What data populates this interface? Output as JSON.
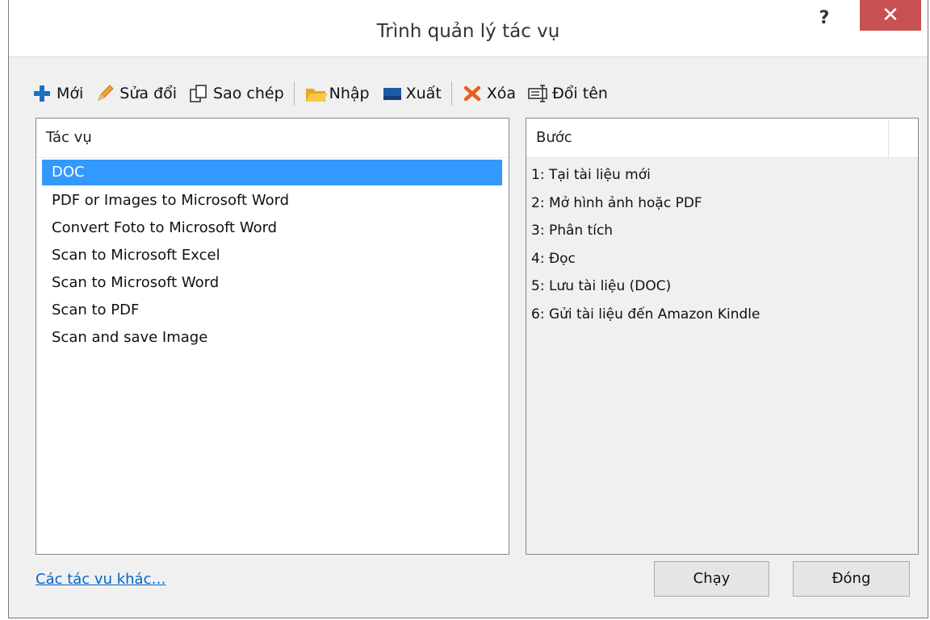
{
  "window": {
    "title": "Trình quản lý tác vụ",
    "help_label": "?",
    "close_label": "✕"
  },
  "toolbar": {
    "new_label": "Mới",
    "edit_label": "Sửa đổi",
    "copy_label": "Sao chép",
    "import_label": "Nhập",
    "export_label": "Xuất",
    "delete_label": "Xóa",
    "rename_label": "Đổi tên"
  },
  "tasks": {
    "header": "Tác vụ",
    "items": [
      "DOC",
      "PDF or Images to Microsoft Word",
      "Convert Foto to Microsoft Word",
      "Scan to Microsoft Excel",
      "Scan to Microsoft Word",
      "Scan to PDF",
      "Scan and save Image"
    ],
    "selected": "DOC"
  },
  "steps": {
    "header": "Bước",
    "items": [
      "1: Tại tài liệu mới",
      "2: Mở hình ảnh hoặc PDF",
      "3: Phân tích",
      "4: Đọc",
      "5: Lưu tài liệu (DOC)",
      "6: Gửi tài liệu đến Amazon Kindle"
    ]
  },
  "footer": {
    "more_link": "Các tác vu khác…",
    "run_label": "Chạy",
    "close_label": "Đóng"
  },
  "colors": {
    "selection": "#3399ff",
    "close_button": "#c75050",
    "link": "#0066cc"
  }
}
